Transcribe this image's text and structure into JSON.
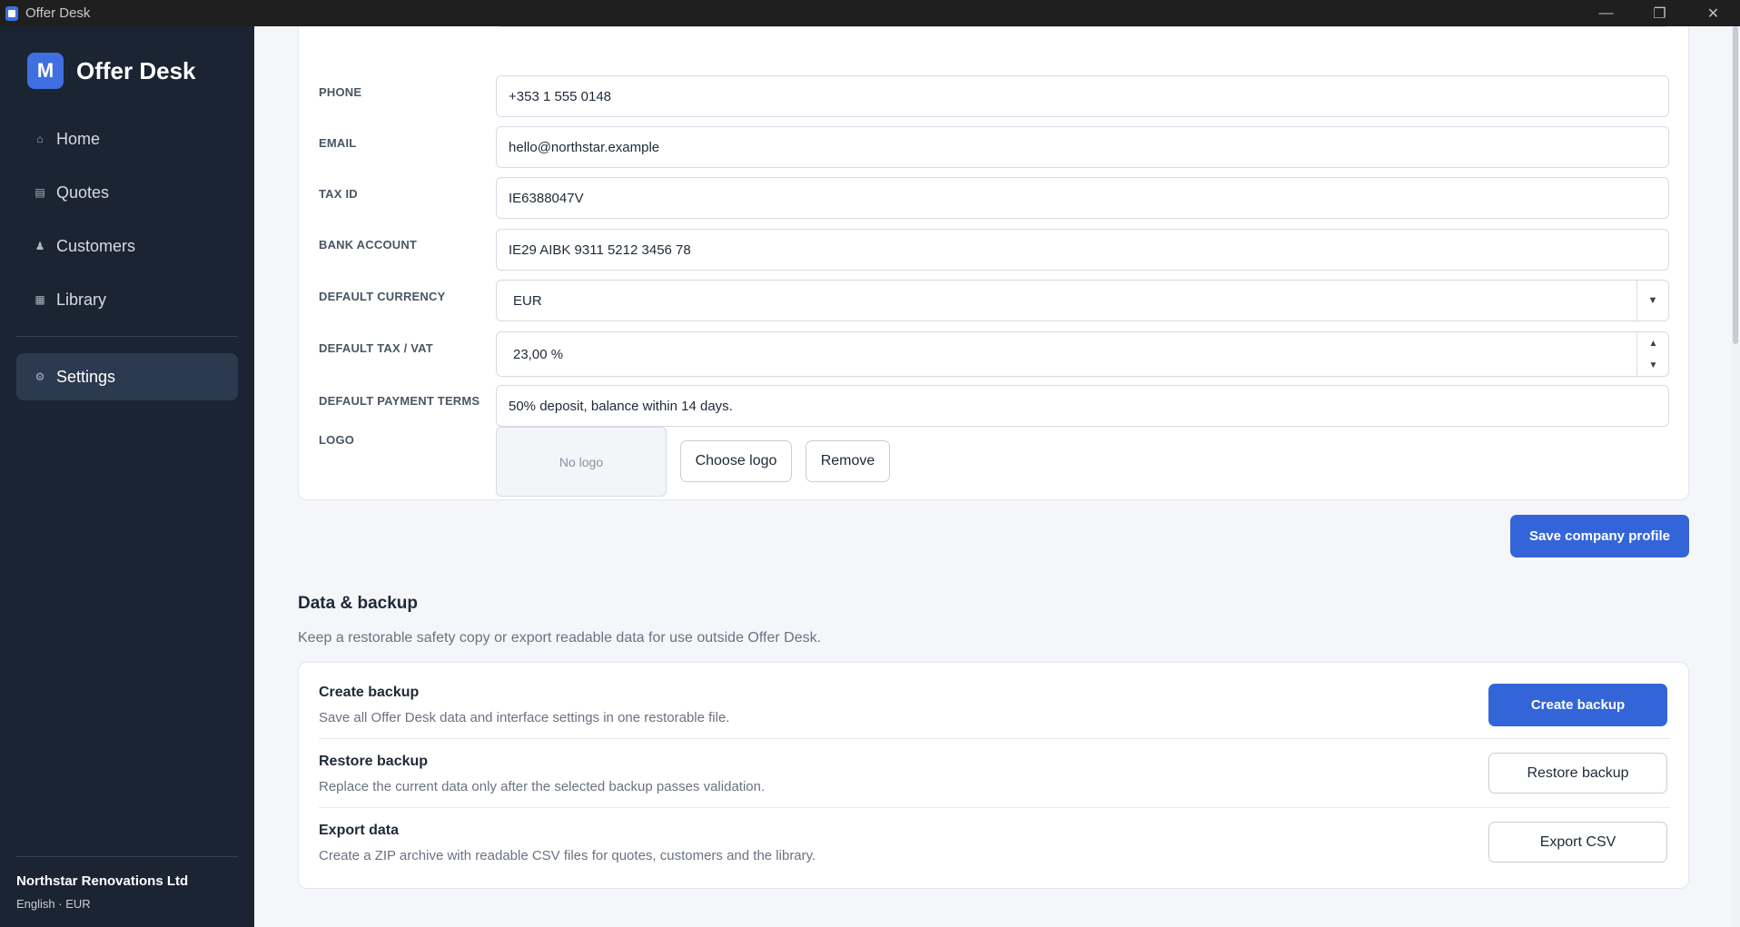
{
  "window": {
    "title": "Offer Desk",
    "minimize": "—",
    "restore": "❐",
    "close": "✕"
  },
  "sidebar": {
    "logo_letter": "M",
    "brand": "Offer Desk",
    "items": [
      {
        "label": "Home",
        "icon": "⌂"
      },
      {
        "label": "Quotes",
        "icon": "▤"
      },
      {
        "label": "Customers",
        "icon": "♟"
      },
      {
        "label": "Library",
        "icon": "▦"
      },
      {
        "label": "Settings",
        "icon": "⚙"
      }
    ],
    "company": "Northstar Renovations Ltd",
    "locale": "English · EUR"
  },
  "profile": {
    "phone_label": "PHONE",
    "phone_value": "+353 1 555 0148",
    "email_label": "EMAIL",
    "email_value": "hello@northstar.example",
    "taxid_label": "TAX ID",
    "taxid_value": "IE6388047V",
    "bank_label": "BANK ACCOUNT",
    "bank_value": "IE29 AIBK 9311 5212 3456 78",
    "currency_label": "DEFAULT CURRENCY",
    "currency_value": "EUR",
    "currency_arrow": "▼",
    "tax_label": "DEFAULT TAX / VAT",
    "tax_value": "23,00 %",
    "spin_up": "▲",
    "spin_down": "▼",
    "terms_label": "DEFAULT PAYMENT TERMS",
    "terms_value": "50% deposit, balance within 14 days.",
    "logo_label": "LOGO",
    "logo_placeholder": "No logo",
    "choose_logo": "Choose logo",
    "remove_logo": "Remove",
    "save": "Save company profile"
  },
  "backup": {
    "title": "Data & backup",
    "description": "Keep a restorable safety copy or export readable data for use outside Offer Desk.",
    "rows": [
      {
        "title": "Create backup",
        "desc": "Save all Offer Desk data and interface settings in one restorable file.",
        "button": "Create backup"
      },
      {
        "title": "Restore backup",
        "desc": "Replace the current data only after the selected backup passes validation.",
        "button": "Restore backup"
      },
      {
        "title": "Export data",
        "desc": "Create a ZIP archive with readable CSV files for quotes, customers and the library.",
        "button": "Export CSV"
      }
    ]
  }
}
